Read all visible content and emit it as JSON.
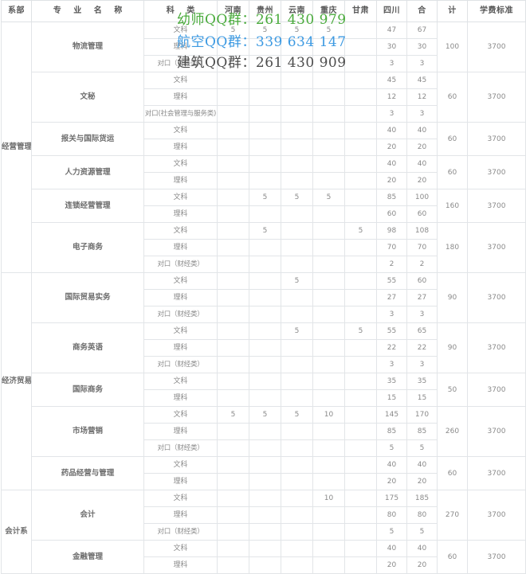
{
  "table": {
    "headers": [
      {
        "key": "dept",
        "label": "系部"
      },
      {
        "key": "major",
        "label": "专  业  名  称"
      },
      {
        "key": "subject",
        "label": "科  类"
      },
      {
        "key": "henan",
        "label": "河南"
      },
      {
        "key": "guizhou",
        "label": "贵州"
      },
      {
        "key": "yunnan",
        "label": "云南"
      },
      {
        "key": "chongqing",
        "label": "重庆"
      },
      {
        "key": "gansu",
        "label": "甘肃"
      },
      {
        "key": "sichuan",
        "label": "四川"
      },
      {
        "key": "he",
        "label": "合"
      },
      {
        "key": "ji",
        "label": "计"
      },
      {
        "key": "fee",
        "label": "学费标准"
      }
    ],
    "departments": [
      {
        "name": "经营管理系",
        "majors": [
          {
            "name": "物流管理",
            "total": "100",
            "fee": "3700",
            "rows": [
              {
                "subject": "文科",
                "henan": "5",
                "guizhou": "5",
                "yunnan": "5",
                "chongqing": "5",
                "gansu": "",
                "sichuan": "47",
                "he": "67"
              },
              {
                "subject": "理科",
                "henan": "",
                "guizhou": "",
                "yunnan": "",
                "chongqing": "",
                "gansu": "",
                "sichuan": "30",
                "he": "30"
              },
              {
                "subject": "对口（财经类）",
                "henan": "",
                "guizhou": "",
                "yunnan": "",
                "chongqing": "",
                "gansu": "",
                "sichuan": "3",
                "he": "3"
              }
            ]
          },
          {
            "name": "文秘",
            "total": "60",
            "fee": "3700",
            "rows": [
              {
                "subject": "文科",
                "henan": "",
                "guizhou": "",
                "yunnan": "",
                "chongqing": "",
                "gansu": "",
                "sichuan": "45",
                "he": "45"
              },
              {
                "subject": "理科",
                "henan": "",
                "guizhou": "",
                "yunnan": "",
                "chongqing": "",
                "gansu": "",
                "sichuan": "12",
                "he": "12"
              },
              {
                "subject": "对口(社会管理与服务类)",
                "henan": "",
                "guizhou": "",
                "yunnan": "",
                "chongqing": "",
                "gansu": "",
                "sichuan": "3",
                "he": "3"
              }
            ]
          },
          {
            "name": "报关与国际货运",
            "total": "60",
            "fee": "3700",
            "rows": [
              {
                "subject": "文科",
                "henan": "",
                "guizhou": "",
                "yunnan": "",
                "chongqing": "",
                "gansu": "",
                "sichuan": "40",
                "he": "40"
              },
              {
                "subject": "理科",
                "henan": "",
                "guizhou": "",
                "yunnan": "",
                "chongqing": "",
                "gansu": "",
                "sichuan": "20",
                "he": "20"
              }
            ]
          },
          {
            "name": "人力资源管理",
            "total": "60",
            "fee": "3700",
            "rows": [
              {
                "subject": "文科",
                "henan": "",
                "guizhou": "",
                "yunnan": "",
                "chongqing": "",
                "gansu": "",
                "sichuan": "40",
                "he": "40"
              },
              {
                "subject": "理科",
                "henan": "",
                "guizhou": "",
                "yunnan": "",
                "chongqing": "",
                "gansu": "",
                "sichuan": "20",
                "he": "20"
              }
            ]
          },
          {
            "name": "连锁经营管理",
            "total": "160",
            "fee": "3700",
            "rows": [
              {
                "subject": "文科",
                "henan": "",
                "guizhou": "5",
                "yunnan": "5",
                "chongqing": "5",
                "gansu": "",
                "sichuan": "85",
                "he": "100"
              },
              {
                "subject": "理科",
                "henan": "",
                "guizhou": "",
                "yunnan": "",
                "chongqing": "",
                "gansu": "",
                "sichuan": "60",
                "he": "60"
              }
            ]
          },
          {
            "name": "电子商务",
            "total": "180",
            "fee": "3700",
            "rows": [
              {
                "subject": "文科",
                "henan": "",
                "guizhou": "5",
                "yunnan": "",
                "chongqing": "",
                "gansu": "5",
                "sichuan": "98",
                "he": "108"
              },
              {
                "subject": "理科",
                "henan": "",
                "guizhou": "",
                "yunnan": "",
                "chongqing": "",
                "gansu": "",
                "sichuan": "70",
                "he": "70"
              },
              {
                "subject": "对口（财经类）",
                "henan": "",
                "guizhou": "",
                "yunnan": "",
                "chongqing": "",
                "gansu": "",
                "sichuan": "2",
                "he": "2"
              }
            ]
          }
        ]
      },
      {
        "name": "经济贸易系",
        "majors": [
          {
            "name": "国际贸易实务",
            "total": "90",
            "fee": "3700",
            "rows": [
              {
                "subject": "文科",
                "henan": "",
                "guizhou": "",
                "yunnan": "5",
                "chongqing": "",
                "gansu": "",
                "sichuan": "55",
                "he": "60"
              },
              {
                "subject": "理科",
                "henan": "",
                "guizhou": "",
                "yunnan": "",
                "chongqing": "",
                "gansu": "",
                "sichuan": "27",
                "he": "27"
              },
              {
                "subject": "对口（财经类）",
                "henan": "",
                "guizhou": "",
                "yunnan": "",
                "chongqing": "",
                "gansu": "",
                "sichuan": "3",
                "he": "3"
              }
            ]
          },
          {
            "name": "商务英语",
            "total": "90",
            "fee": "3700",
            "rows": [
              {
                "subject": "文科",
                "henan": "",
                "guizhou": "",
                "yunnan": "5",
                "chongqing": "",
                "gansu": "5",
                "sichuan": "55",
                "he": "65"
              },
              {
                "subject": "理科",
                "henan": "",
                "guizhou": "",
                "yunnan": "",
                "chongqing": "",
                "gansu": "",
                "sichuan": "22",
                "he": "22"
              },
              {
                "subject": "对口（财经类）",
                "henan": "",
                "guizhou": "",
                "yunnan": "",
                "chongqing": "",
                "gansu": "",
                "sichuan": "3",
                "he": "3"
              }
            ]
          },
          {
            "name": "国际商务",
            "total": "50",
            "fee": "3700",
            "rows": [
              {
                "subject": "文科",
                "henan": "",
                "guizhou": "",
                "yunnan": "",
                "chongqing": "",
                "gansu": "",
                "sichuan": "35",
                "he": "35"
              },
              {
                "subject": "理科",
                "henan": "",
                "guizhou": "",
                "yunnan": "",
                "chongqing": "",
                "gansu": "",
                "sichuan": "15",
                "he": "15"
              }
            ]
          },
          {
            "name": "市场营销",
            "total": "260",
            "fee": "3700",
            "rows": [
              {
                "subject": "文科",
                "henan": "5",
                "guizhou": "5",
                "yunnan": "5",
                "chongqing": "10",
                "gansu": "",
                "sichuan": "145",
                "he": "170"
              },
              {
                "subject": "理科",
                "henan": "",
                "guizhou": "",
                "yunnan": "",
                "chongqing": "",
                "gansu": "",
                "sichuan": "85",
                "he": "85"
              },
              {
                "subject": "对口（财经类）",
                "henan": "",
                "guizhou": "",
                "yunnan": "",
                "chongqing": "",
                "gansu": "",
                "sichuan": "5",
                "he": "5"
              }
            ]
          },
          {
            "name": "药品经营与管理",
            "total": "60",
            "fee": "3700",
            "rows": [
              {
                "subject": "文科",
                "henan": "",
                "guizhou": "",
                "yunnan": "",
                "chongqing": "",
                "gansu": "",
                "sichuan": "40",
                "he": "40"
              },
              {
                "subject": "理科",
                "henan": "",
                "guizhou": "",
                "yunnan": "",
                "chongqing": "",
                "gansu": "",
                "sichuan": "20",
                "he": "20"
              }
            ]
          }
        ]
      },
      {
        "name": "会计系",
        "majors": [
          {
            "name": "会计",
            "total": "270",
            "fee": "3700",
            "rows": [
              {
                "subject": "文科",
                "henan": "",
                "guizhou": "",
                "yunnan": "",
                "chongqing": "10",
                "gansu": "",
                "sichuan": "175",
                "he": "185"
              },
              {
                "subject": "理科",
                "henan": "",
                "guizhou": "",
                "yunnan": "",
                "chongqing": "",
                "gansu": "",
                "sichuan": "80",
                "he": "80"
              },
              {
                "subject": "对口（财经类）",
                "henan": "",
                "guizhou": "",
                "yunnan": "",
                "chongqing": "",
                "gansu": "",
                "sichuan": "5",
                "he": "5"
              }
            ]
          },
          {
            "name": "金融管理",
            "total": "60",
            "fee": "3700",
            "rows": [
              {
                "subject": "文科",
                "henan": "",
                "guizhou": "",
                "yunnan": "",
                "chongqing": "",
                "gansu": "",
                "sichuan": "40",
                "he": "40"
              },
              {
                "subject": "理科",
                "henan": "",
                "guizhou": "",
                "yunnan": "",
                "chongqing": "",
                "gansu": "",
                "sichuan": "20",
                "he": "20"
              }
            ]
          }
        ]
      }
    ]
  },
  "watermarks": [
    {
      "text": "幼师QQ群：261 430 979",
      "color": "#4aab3c"
    },
    {
      "text": "航空QQ群：339 634 147",
      "color": "#3d9ae2"
    },
    {
      "text": "建筑QQ群：261 430 909",
      "color": "#4d4d4d"
    }
  ]
}
